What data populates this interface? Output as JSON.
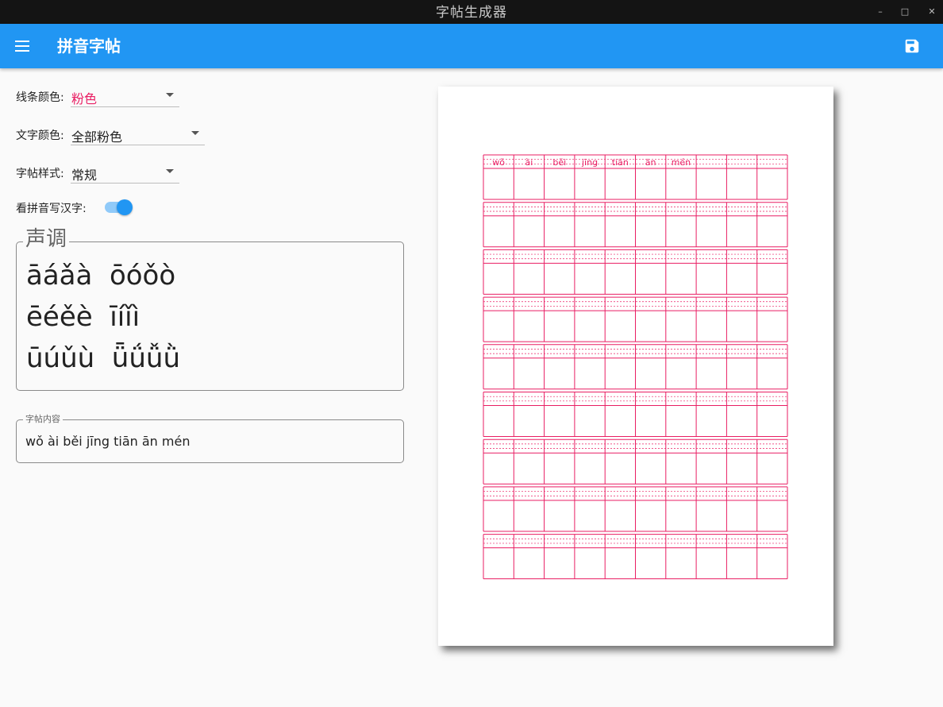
{
  "window": {
    "title": "字帖生成器"
  },
  "appbar": {
    "title": "拼音字帖"
  },
  "settings": {
    "line_color": {
      "label": "线条颜色:",
      "value": "粉色"
    },
    "text_color": {
      "label": "文字颜色:",
      "value": "全部粉色"
    },
    "style": {
      "label": "字帖样式:",
      "value": "常规"
    },
    "pinyin_to_hanzi": {
      "label": "看拼音写汉字:",
      "enabled": true
    }
  },
  "tones": {
    "legend": "声调",
    "rows": [
      "āáǎà  ōóǒò",
      "ēéěè  īíǐì",
      "ūúǔù  ǖǘǚǜ"
    ]
  },
  "content": {
    "legend": "字帖内容",
    "value": "wǒ ài běi jīng tiān ān mén"
  },
  "preview": {
    "line_color": "#e91e63",
    "columns": 10,
    "rows": 9,
    "pinyin": [
      "wǒ",
      "ài",
      "běi",
      "jīng",
      "tiān",
      "ān",
      "mén"
    ]
  },
  "colors": {
    "appbar": "#2196f3",
    "accent_pink": "#e91e63",
    "titlebar": "#141414"
  }
}
